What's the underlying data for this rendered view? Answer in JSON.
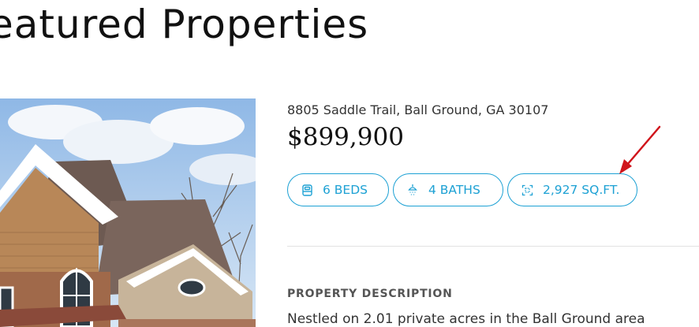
{
  "section": {
    "title": "eatured Properties"
  },
  "property": {
    "address": "8805 Saddle Trail, Ball Ground, GA 30107",
    "price": "$899,900",
    "features": {
      "beds": "6 BEDS",
      "baths": "4 BATHS",
      "sqft": "2,927 SQ.FT."
    },
    "description_heading": "PROPERTY DESCRIPTION",
    "description_text": "Nestled on 2.01 private acres in the Ball Ground area"
  },
  "icons": {
    "beds": "bed-icon",
    "baths": "shower-icon",
    "sqft": "area-icon"
  },
  "colors": {
    "accent": "#1da1d4",
    "annotation_arrow": "#d0141b"
  }
}
